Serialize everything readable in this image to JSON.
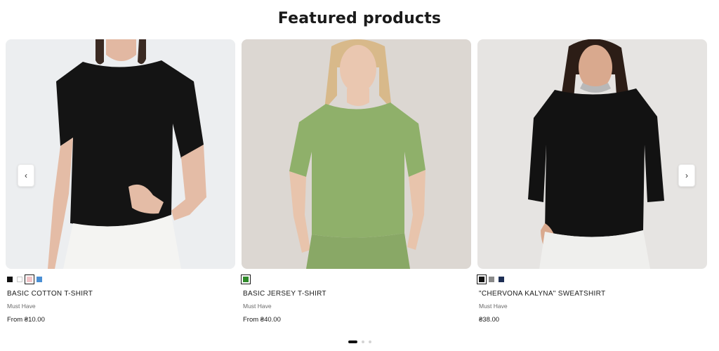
{
  "section": {
    "title": "Featured products"
  },
  "carousel": {
    "prev_icon": "chevron-left-icon",
    "next_icon": "chevron-right-icon",
    "prev_glyph": "‹",
    "next_glyph": "›",
    "pages": 3,
    "active_page": 1
  },
  "products": [
    {
      "title": "BASIC COTTON T-SHIRT",
      "vendor": "Must Have",
      "price": "From ₴10.00",
      "swatches": [
        "#111111",
        "#ffffff",
        "#f2c4c8",
        "#4a8fd4"
      ],
      "selected_swatch": 2
    },
    {
      "title": "BASIC JERSEY T-SHIRT",
      "vendor": "Must Have",
      "price": "From ₴40.00",
      "swatches": [
        "#2f8a2a"
      ],
      "selected_swatch": 0
    },
    {
      "title": "\"CHERVONA KALYNA\" SWEATSHIRT",
      "vendor": "Must Have",
      "price": "₴38.00",
      "swatches": [
        "#111111",
        "#8a8a8a",
        "#1e2f55"
      ],
      "selected_swatch": 0
    }
  ]
}
